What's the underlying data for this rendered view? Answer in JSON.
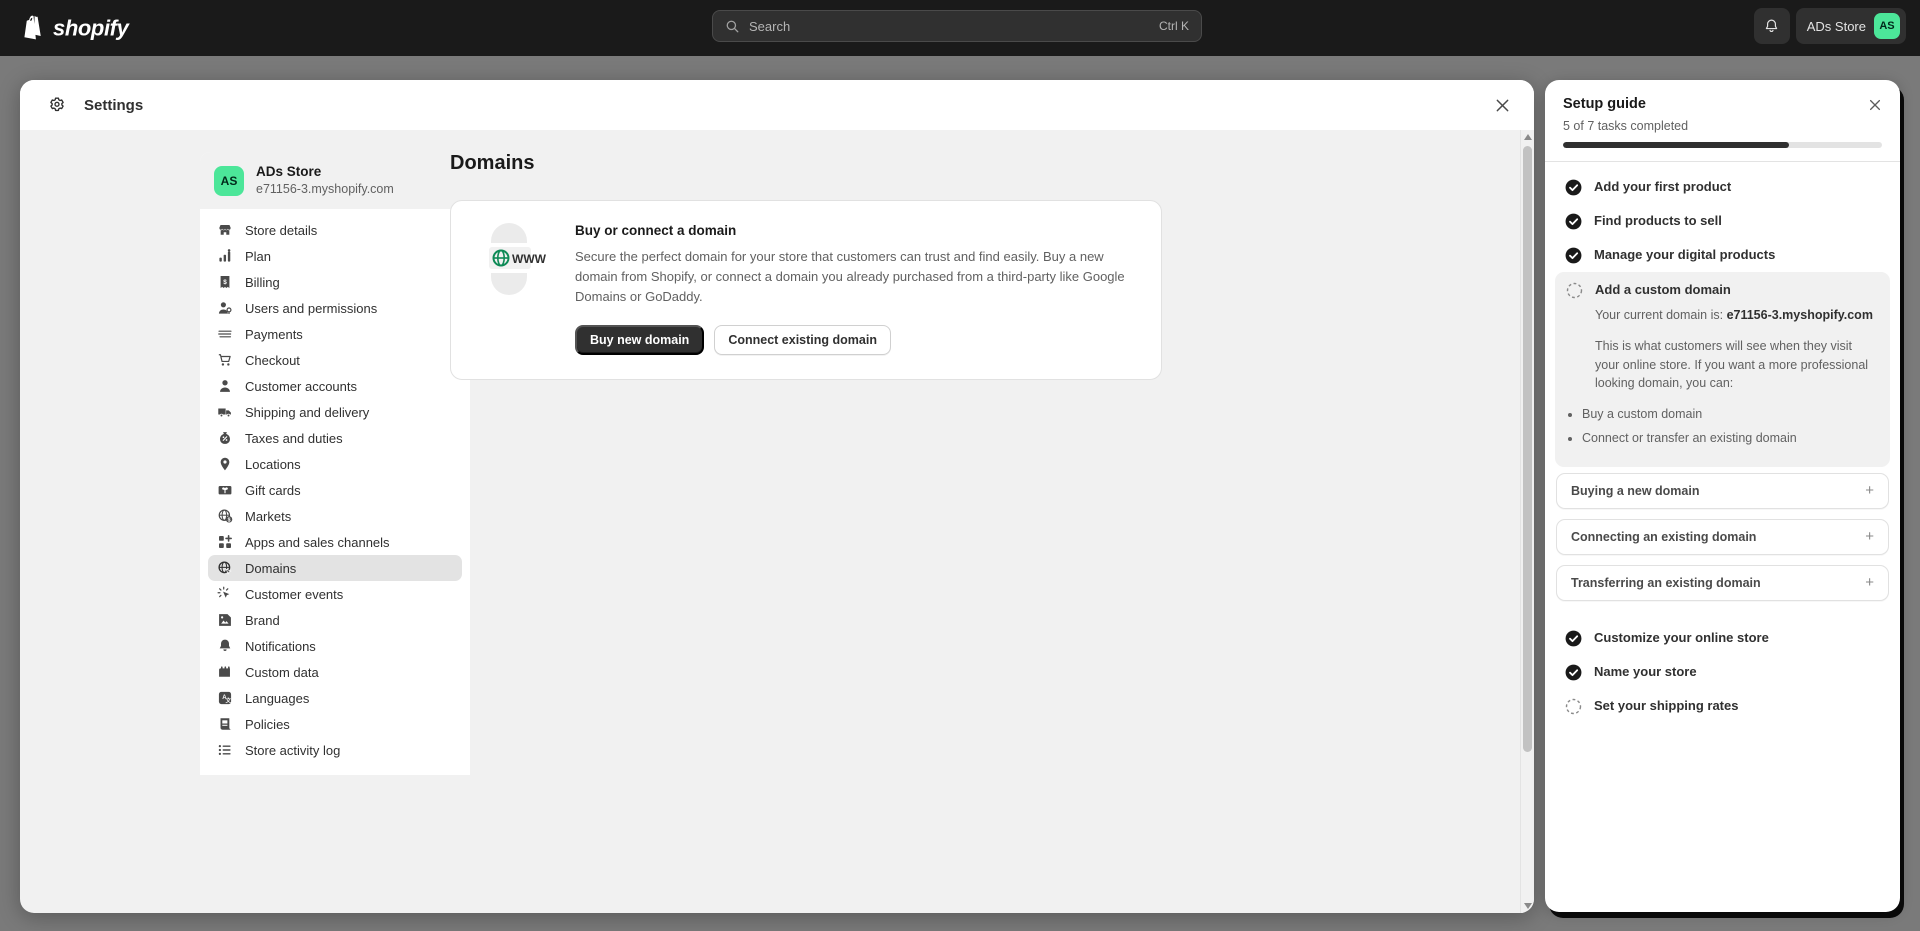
{
  "topbar": {
    "logo_text": "shopify",
    "search": {
      "placeholder": "Search",
      "shortcut": "Ctrl K"
    },
    "store_name": "ADs Store",
    "avatar_initials": "AS"
  },
  "settings_modal": {
    "title": "Settings",
    "store": {
      "initials": "AS",
      "name": "ADs Store",
      "domain": "e71156-3.myshopify.com"
    },
    "nav_items": [
      {
        "label": "Store details",
        "icon": "store-icon",
        "active": false
      },
      {
        "label": "Plan",
        "icon": "plan-icon",
        "active": false
      },
      {
        "label": "Billing",
        "icon": "billing-icon",
        "active": false
      },
      {
        "label": "Users and permissions",
        "icon": "users-icon",
        "active": false
      },
      {
        "label": "Payments",
        "icon": "payments-icon",
        "active": false
      },
      {
        "label": "Checkout",
        "icon": "cart-icon",
        "active": false
      },
      {
        "label": "Customer accounts",
        "icon": "person-icon",
        "active": false
      },
      {
        "label": "Shipping and delivery",
        "icon": "truck-icon",
        "active": false
      },
      {
        "label": "Taxes and duties",
        "icon": "taxes-icon",
        "active": false
      },
      {
        "label": "Locations",
        "icon": "pin-icon",
        "active": false
      },
      {
        "label": "Gift cards",
        "icon": "gift-card-icon",
        "active": false
      },
      {
        "label": "Markets",
        "icon": "globe-dollar-icon",
        "active": false
      },
      {
        "label": "Apps and sales channels",
        "icon": "apps-plus-icon",
        "active": false
      },
      {
        "label": "Domains",
        "icon": "globe-cursor-icon",
        "active": true
      },
      {
        "label": "Customer events",
        "icon": "click-icon",
        "active": false
      },
      {
        "label": "Brand",
        "icon": "brand-icon",
        "active": false
      },
      {
        "label": "Notifications",
        "icon": "bell-icon",
        "active": false
      },
      {
        "label": "Custom data",
        "icon": "custom-data-icon",
        "active": false
      },
      {
        "label": "Languages",
        "icon": "languages-icon",
        "active": false
      },
      {
        "label": "Policies",
        "icon": "policies-icon",
        "active": false
      },
      {
        "label": "Store activity log",
        "icon": "list-icon",
        "active": false
      }
    ],
    "page": {
      "heading": "Domains",
      "card": {
        "title": "Buy or connect a domain",
        "description": "Secure the perfect domain for your store that customers can trust and find easily. Buy a new domain from Shopify, or connect a domain you already purchased from a third-party like Google Domains or GoDaddy.",
        "illustration": "www-globe-icon",
        "illustration_label": "WWW",
        "primary_button": "Buy new domain",
        "secondary_button": "Connect existing domain"
      }
    }
  },
  "setup_guide": {
    "title": "Setup guide",
    "subtitle": "5 of 7 tasks completed",
    "progress_percent": 71,
    "tasks_top": [
      {
        "label": "Add your first product",
        "done": true
      },
      {
        "label": "Find products to sell",
        "done": true
      },
      {
        "label": "Manage your digital products",
        "done": true
      }
    ],
    "active_task": {
      "label": "Add a custom domain",
      "done": false,
      "current_domain_prefix": "Your current domain is: ",
      "current_domain": "e71156-3.myshopify.com",
      "body": "This is what customers will see when they visit your online store. If you want a more professional looking domain, you can:",
      "bullets": [
        "Buy a custom domain",
        "Connect or transfer an existing domain"
      ]
    },
    "accordions": [
      {
        "title": "Buying a new domain",
        "expand_icon": "plus-icon"
      },
      {
        "title": "Connecting an existing domain",
        "expand_icon": "plus-icon"
      },
      {
        "title": "Transferring an existing domain",
        "expand_icon": "plus-icon"
      }
    ],
    "tasks_bottom": [
      {
        "label": "Customize your online store",
        "done": true
      },
      {
        "label": "Name your store",
        "done": true
      },
      {
        "label": "Set your shipping rates",
        "done": false
      }
    ]
  },
  "colors": {
    "accent_green": "#4ce699",
    "dark": "#303030",
    "globe_green": "#0e8a56"
  }
}
